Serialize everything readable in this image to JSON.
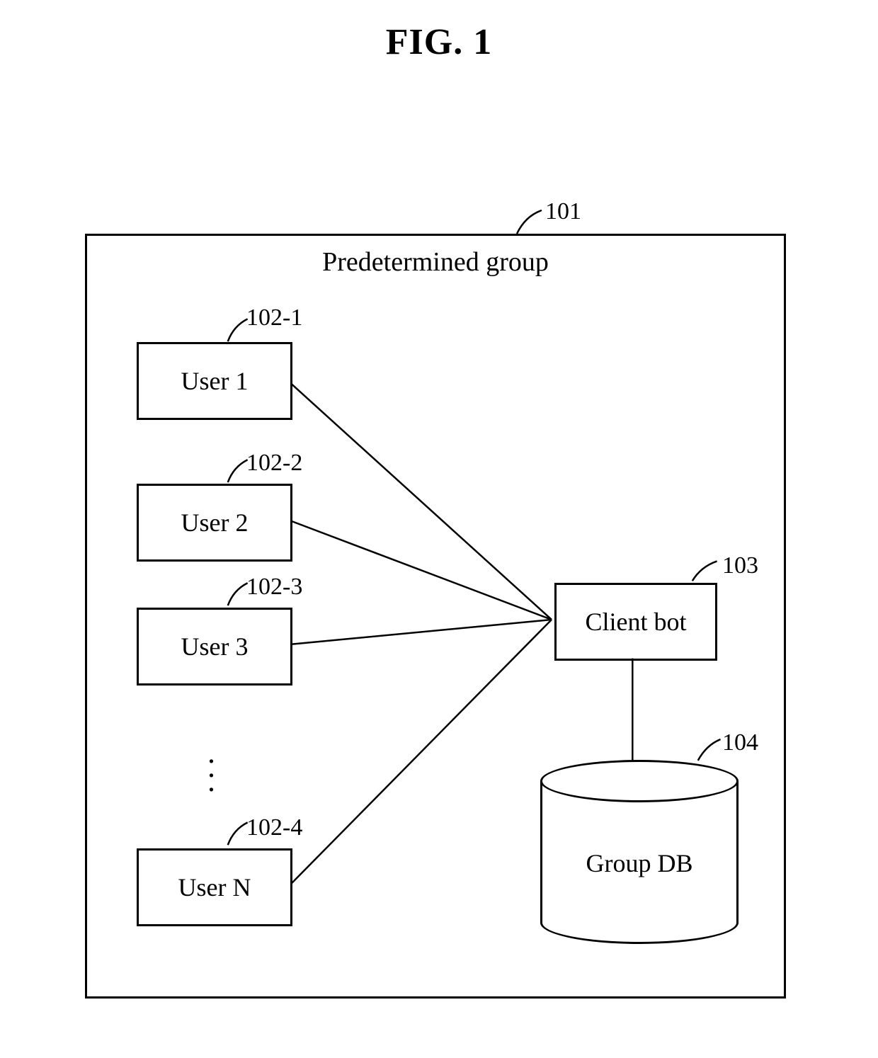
{
  "figure": {
    "title": "FIG. 1",
    "group_title": "Predetermined group",
    "users": {
      "u1": "User 1",
      "u2": "User 2",
      "u3": "User 3",
      "uN": "User N"
    },
    "client_bot": "Client bot",
    "group_db": "Group DB",
    "refs": {
      "r101": "101",
      "r102_1": "102-1",
      "r102_2": "102-2",
      "r102_3": "102-3",
      "r102_4": "102-4",
      "r103": "103",
      "r104": "104"
    }
  }
}
